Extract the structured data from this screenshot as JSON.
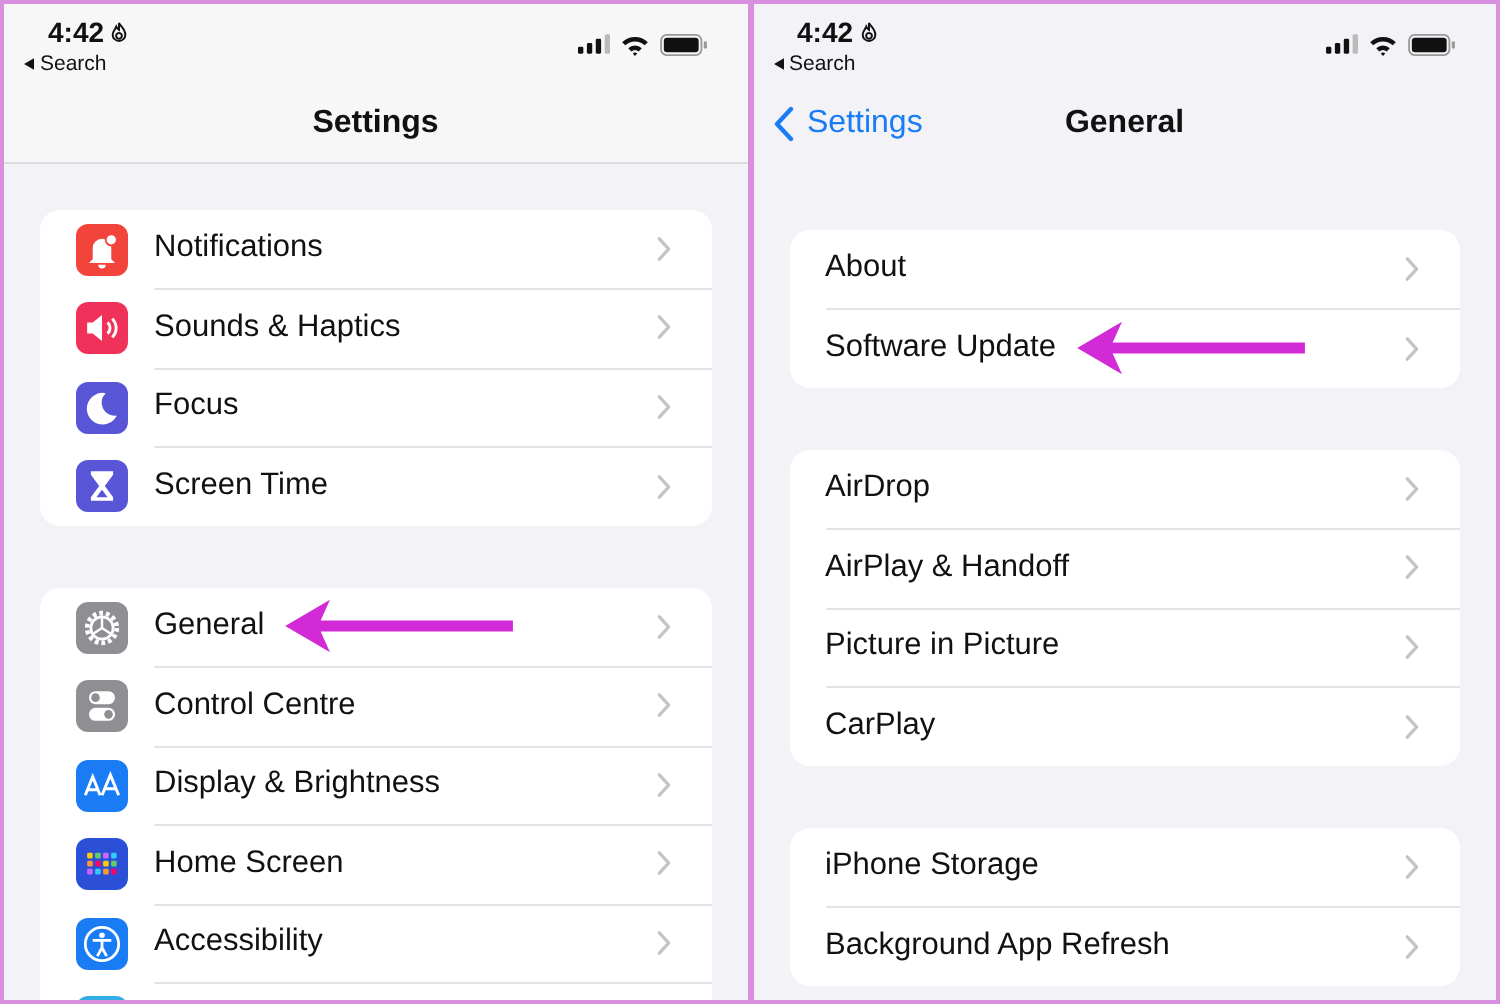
{
  "screens": [
    {
      "status": {
        "time": "4:42",
        "back_app": "Search"
      },
      "nav": {
        "title": "Settings"
      },
      "divider": true,
      "groups": [
        [
          {
            "label": "Notifications",
            "color": "#f2443a",
            "annotated": false
          },
          {
            "label": "Sounds & Haptics",
            "color": "#f0325a",
            "annotated": false
          },
          {
            "label": "Focus",
            "color": "#5856d6",
            "annotated": false
          },
          {
            "label": "Screen Time",
            "color": "#5856d6",
            "annotated": false
          }
        ],
        [
          {
            "label": "General",
            "color": "#8e8e93",
            "annotated": true
          },
          {
            "label": "Control Centre",
            "color": "#8e8e93",
            "annotated": false
          },
          {
            "label": "Display & Brightness",
            "color": "#1a7cf5",
            "annotated": false
          },
          {
            "label": "Home Screen",
            "color": "#2c4fd8",
            "annotated": false
          },
          {
            "label": "Accessibility",
            "color": "#1a7cf5",
            "annotated": false
          },
          {
            "color": "#32ade6",
            "annotated": false
          }
        ]
      ]
    },
    {
      "status": {
        "time": "4:42",
        "back_app": "Search"
      },
      "nav": {
        "back": "Settings",
        "title": "General"
      },
      "divider": false,
      "groups": [
        [
          {
            "label": "About",
            "annotated": false
          },
          {
            "label": "Software Update",
            "annotated": true
          }
        ],
        [
          {
            "label": "AirDrop",
            "annotated": false
          },
          {
            "label": "AirPlay & Handoff",
            "annotated": false
          },
          {
            "label": "Picture in Picture",
            "annotated": false
          },
          {
            "label": "CarPlay",
            "annotated": false
          }
        ],
        [
          {
            "label": "iPhone Storage",
            "annotated": false
          },
          {
            "label": "Background App Refresh",
            "annotated": false
          }
        ]
      ]
    }
  ]
}
